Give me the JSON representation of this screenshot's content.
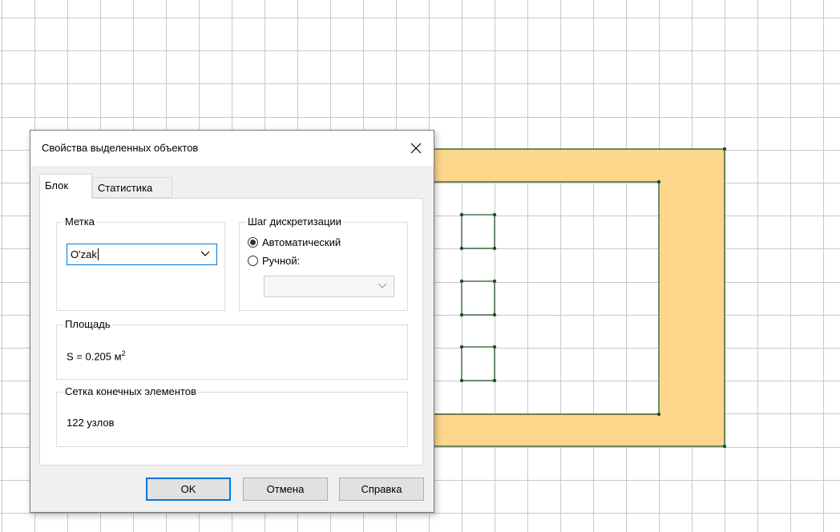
{
  "dialog": {
    "title": "Свойства выделенных объектов",
    "close_label": "✕"
  },
  "tabs": [
    {
      "label": "Блок",
      "active": true
    },
    {
      "label": "Статистика",
      "active": false
    }
  ],
  "label_group": {
    "title": "Метка",
    "value": "O'zak"
  },
  "discretization": {
    "title": "Шаг дискретизации",
    "options": [
      {
        "label": "Автоматический",
        "checked": true
      },
      {
        "label": "Ручной:",
        "checked": false
      }
    ],
    "manual_value": ""
  },
  "area": {
    "title": "Площадь",
    "prefix": "S = 0.205 м",
    "exponent": "2"
  },
  "mesh": {
    "title": "Сетка конечных элементов",
    "value": "122 узлов"
  },
  "buttons": {
    "ok": "OK",
    "cancel": "Отмена",
    "help": "Справка"
  },
  "colors": {
    "block_fill": "#fdd78b",
    "outline": "#1f4d1f",
    "grid": "#c8c8c8",
    "accent": "#0078d7"
  },
  "icons": {
    "close": "close-icon",
    "dropdown": "chevron-down-icon"
  }
}
